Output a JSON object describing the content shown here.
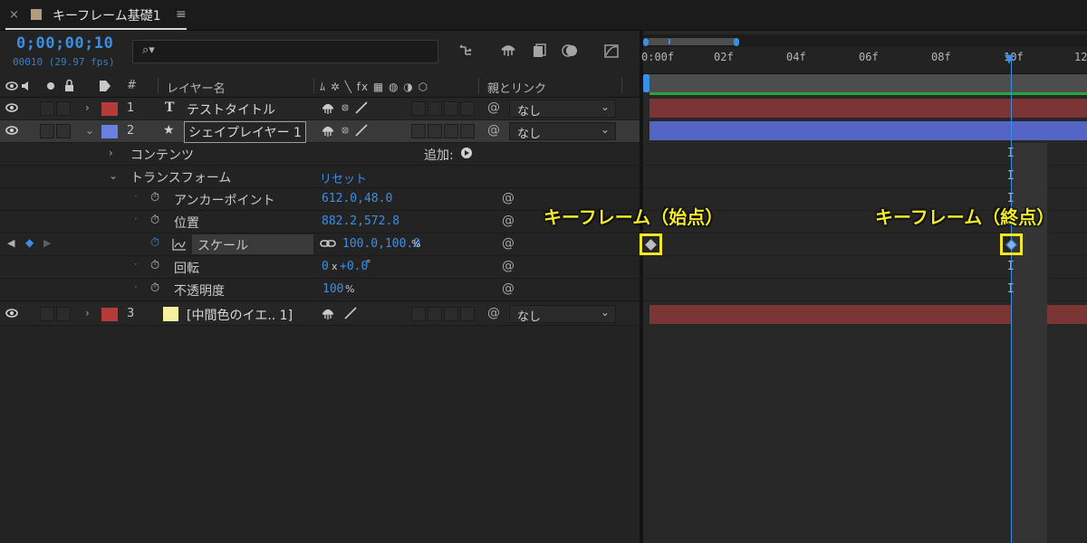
{
  "tab": {
    "close": "×",
    "title": "キーフレーム基礎1",
    "menu": "≡",
    "swatch_color": "#b39c7b"
  },
  "time": {
    "timecode": "0;00;00;10",
    "frames": "00010 (29.97 fps)"
  },
  "search": {
    "icon": "⌕▾",
    "placeholder": ""
  },
  "toolbar": {
    "icons": [
      "composition-mini-flowchart-icon",
      "draft-3d-icon",
      "frame-blending-icon",
      "motion-blur-icon",
      "graph-editor-icon"
    ]
  },
  "columns": {
    "switches_left": "◉🔈 ● 🔒",
    "label": "🏷",
    "number": "#",
    "layer_name": "レイヤー名",
    "switches": "ﾑ ✲ ╲ fx ▦ ◍ ◑ ⬡",
    "parent": "親とリンク"
  },
  "layers": [
    {
      "number": "1",
      "type": "T",
      "name": "テストタイトル",
      "label_color": "#b53b3b",
      "parent": "なし",
      "twirl": "›"
    },
    {
      "number": "2",
      "type": "★",
      "name": "シェイプレイヤー 1",
      "label_color": "#6a7fe0",
      "parent": "なし",
      "twirl": "⌄"
    },
    {
      "number": "3",
      "type": "",
      "name": "[中間色のイエ.. 1]",
      "label_color": "#b53b3b",
      "parent": "なし",
      "twirl": "›",
      "swatch": "#f4f0a0"
    }
  ],
  "properties": {
    "contents": "コンテンツ",
    "add": "追加:",
    "transform": "トランスフォーム",
    "reset": "リセット",
    "anchor": {
      "label": "アンカーポイント",
      "value": "612.0,48.0"
    },
    "position": {
      "label": "位置",
      "value": "882.2,572.8"
    },
    "scale": {
      "label": "スケール",
      "value": "100.0,100.0",
      "unit": "%"
    },
    "rotation": {
      "label": "回転",
      "value": "0",
      "value2": "+0.0",
      "unit": "°"
    },
    "opacity": {
      "label": "不透明度",
      "value": "100",
      "unit": "%"
    }
  },
  "ruler": {
    "ticks": [
      "0:00f",
      "02f",
      "04f",
      "06f",
      "08f",
      "10f",
      "12"
    ]
  },
  "annotations": {
    "start": "キーフレーム（始点）",
    "end": "キーフレーム（終点）"
  },
  "colors": {
    "accent": "#3b8fe3",
    "annotation": "#f3ea2b",
    "layer_bar_red": "#7b3535",
    "layer_bar_blue": "#5565c6",
    "work_area_green": "#27a63a"
  }
}
